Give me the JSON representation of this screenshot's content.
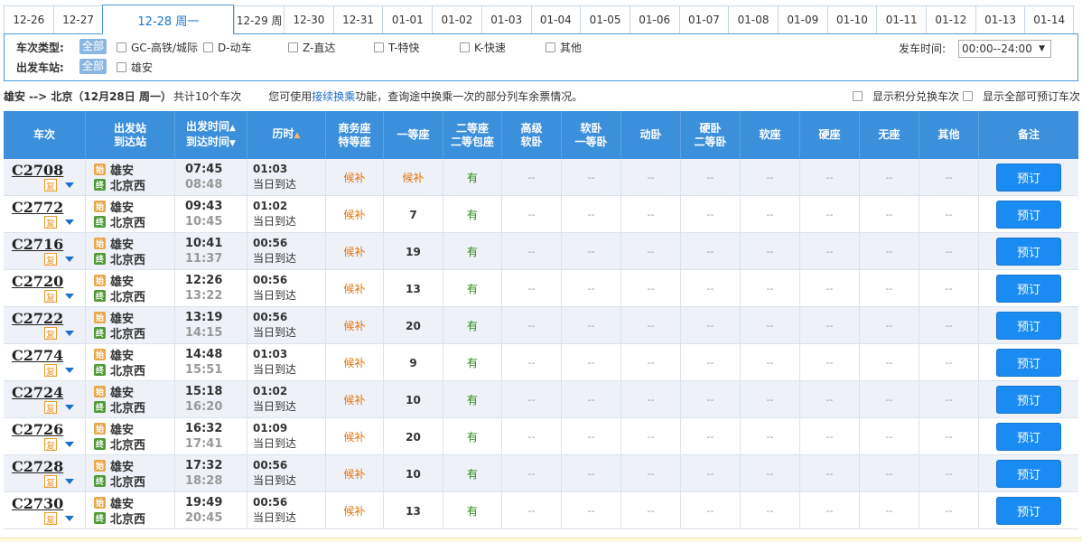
{
  "dates": [
    {
      "label": "12-26"
    },
    {
      "label": "12-27"
    },
    {
      "label": "12-28 周一",
      "active": true
    },
    {
      "label": "12-29 周"
    },
    {
      "label": "12-30"
    },
    {
      "label": "12-31"
    },
    {
      "label": "01-01"
    },
    {
      "label": "01-02"
    },
    {
      "label": "01-03"
    },
    {
      "label": "01-04"
    },
    {
      "label": "01-05"
    },
    {
      "label": "01-06"
    },
    {
      "label": "01-07"
    },
    {
      "label": "01-08"
    },
    {
      "label": "01-09"
    },
    {
      "label": "01-10"
    },
    {
      "label": "01-11"
    },
    {
      "label": "01-12"
    },
    {
      "label": "01-13"
    },
    {
      "label": "01-14"
    }
  ],
  "filters": {
    "train_type_label": "车次类型:",
    "all_label": "全部",
    "types": [
      "GC-高铁/城际",
      "D-动车",
      "Z-直达",
      "T-特快",
      "K-快速",
      "其他"
    ],
    "depart_station_label": "出发车站:",
    "stations": [
      "雄安"
    ],
    "depart_time_label": "发车时间:",
    "depart_time_value": "00:00--24:00"
  },
  "summary": {
    "route": "雄安 --> 北京（12月28日  周一）",
    "count_text": "共计10个车次",
    "hint_prefix": "您可使用",
    "hint_link": "接续换乘",
    "hint_suffix": "功能，查询途中换乘一次的部分列车余票情况。",
    "opt1": "显示积分兑换车次",
    "opt2": "显示全部可预订车次"
  },
  "headers": {
    "train": "车次",
    "stations": [
      "出发站",
      "到达站"
    ],
    "times": [
      "出发时间",
      "到达时间"
    ],
    "duration": "历时",
    "business": [
      "商务座",
      "特等座"
    ],
    "first": "一等座",
    "second": [
      "二等座",
      "二等包座"
    ],
    "hisoft": [
      "高级",
      "软卧"
    ],
    "soft_sleeper": [
      "软卧",
      "一等卧"
    ],
    "moving_sleeper": "动卧",
    "hard_sleeper": [
      "硬卧",
      "二等卧"
    ],
    "soft_seat": "软座",
    "hard_seat": "硬座",
    "no_seat": "无座",
    "other": "其他",
    "remark": "备注",
    "sort_up": "▲",
    "sort_down": "▼"
  },
  "labels": {
    "fuxing": "复",
    "start_icon": "始",
    "end_icon": "终",
    "dash": "--",
    "book": "预订"
  },
  "trains": [
    {
      "no": "C2708",
      "from": "雄安",
      "to": "北京西",
      "dep": "07:45",
      "arr": "08:48",
      "dur": "01:03",
      "day": "当日到达",
      "business": "候补",
      "first": "候补",
      "second": "有"
    },
    {
      "no": "C2772",
      "from": "雄安",
      "to": "北京西",
      "dep": "09:43",
      "arr": "10:45",
      "dur": "01:02",
      "day": "当日到达",
      "business": "候补",
      "first": "7",
      "second": "有"
    },
    {
      "no": "C2716",
      "from": "雄安",
      "to": "北京西",
      "dep": "10:41",
      "arr": "11:37",
      "dur": "00:56",
      "day": "当日到达",
      "business": "候补",
      "first": "19",
      "second": "有"
    },
    {
      "no": "C2720",
      "from": "雄安",
      "to": "北京西",
      "dep": "12:26",
      "arr": "13:22",
      "dur": "00:56",
      "day": "当日到达",
      "business": "候补",
      "first": "13",
      "second": "有"
    },
    {
      "no": "C2722",
      "from": "雄安",
      "to": "北京西",
      "dep": "13:19",
      "arr": "14:15",
      "dur": "00:56",
      "day": "当日到达",
      "business": "候补",
      "first": "20",
      "second": "有"
    },
    {
      "no": "C2774",
      "from": "雄安",
      "to": "北京西",
      "dep": "14:48",
      "arr": "15:51",
      "dur": "01:03",
      "day": "当日到达",
      "business": "候补",
      "first": "9",
      "second": "有"
    },
    {
      "no": "C2724",
      "from": "雄安",
      "to": "北京西",
      "dep": "15:18",
      "arr": "16:20",
      "dur": "01:02",
      "day": "当日到达",
      "business": "候补",
      "first": "10",
      "second": "有"
    },
    {
      "no": "C2726",
      "from": "雄安",
      "to": "北京西",
      "dep": "16:32",
      "arr": "17:41",
      "dur": "01:09",
      "day": "当日到达",
      "business": "候补",
      "first": "20",
      "second": "有"
    },
    {
      "no": "C2728",
      "from": "雄安",
      "to": "北京西",
      "dep": "17:32",
      "arr": "18:28",
      "dur": "00:56",
      "day": "当日到达",
      "business": "候补",
      "first": "10",
      "second": "有"
    },
    {
      "no": "C2730",
      "from": "雄安",
      "to": "北京西",
      "dep": "19:49",
      "arr": "20:45",
      "dur": "00:56",
      "day": "当日到达",
      "business": "候补",
      "first": "13",
      "second": "有"
    }
  ]
}
